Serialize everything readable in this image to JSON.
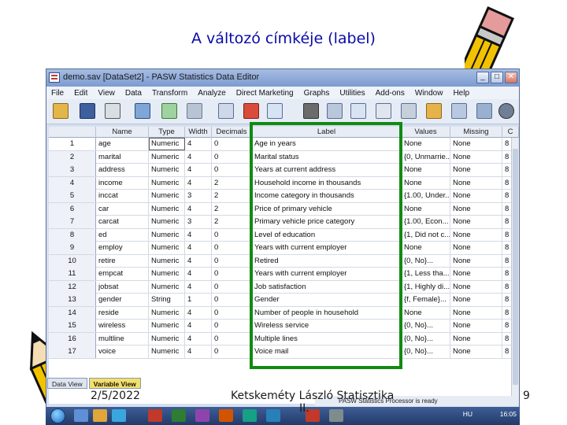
{
  "slide": {
    "title": "A változó címkéje (label)",
    "footer_date": "2/5/2022",
    "footer_author_line1": "Ketskeméty László Statisztika",
    "footer_author_line2": "II.",
    "page_number": "9"
  },
  "window": {
    "title": "demo.sav [DataSet2] - PASW Statistics Data Editor",
    "minimize": "_",
    "maximize": "□",
    "close": "✕"
  },
  "menu": [
    "File",
    "Edit",
    "View",
    "Data",
    "Transform",
    "Analyze",
    "Direct Marketing",
    "Graphs",
    "Utilities",
    "Add-ons",
    "Window",
    "Help"
  ],
  "columns": [
    "Name",
    "Type",
    "Width",
    "Decimals",
    "Label",
    "Values",
    "Missing",
    "C"
  ],
  "rows": [
    {
      "n": "1",
      "name": "age",
      "type": "Numeric",
      "width": "4",
      "dec": "0",
      "label": "Age in years",
      "values": "None",
      "missing": "None",
      "c": "8"
    },
    {
      "n": "2",
      "name": "marital",
      "type": "Numeric",
      "width": "4",
      "dec": "0",
      "label": "Marital status",
      "values": "{0, Unmarrie...",
      "missing": "None",
      "c": "8"
    },
    {
      "n": "3",
      "name": "address",
      "type": "Numeric",
      "width": "4",
      "dec": "0",
      "label": "Years at current address",
      "values": "None",
      "missing": "None",
      "c": "8"
    },
    {
      "n": "4",
      "name": "income",
      "type": "Numeric",
      "width": "4",
      "dec": "2",
      "label": "Household income in thousands",
      "values": "None",
      "missing": "None",
      "c": "8"
    },
    {
      "n": "5",
      "name": "inccat",
      "type": "Numeric",
      "width": "3",
      "dec": "2",
      "label": "Income category in thousands",
      "values": "{1.00, Under...",
      "missing": "None",
      "c": "8"
    },
    {
      "n": "6",
      "name": "car",
      "type": "Numeric",
      "width": "4",
      "dec": "2",
      "label": "Price of primary vehicle",
      "values": "None",
      "missing": "None",
      "c": "8"
    },
    {
      "n": "7",
      "name": "carcat",
      "type": "Numeric",
      "width": "3",
      "dec": "2",
      "label": "Primary vehicle price category",
      "values": "{1.00, Econ...",
      "missing": "None",
      "c": "8"
    },
    {
      "n": "8",
      "name": "ed",
      "type": "Numeric",
      "width": "4",
      "dec": "0",
      "label": "Level of education",
      "values": "{1, Did not c...",
      "missing": "None",
      "c": "8"
    },
    {
      "n": "9",
      "name": "employ",
      "type": "Numeric",
      "width": "4",
      "dec": "0",
      "label": "Years with current employer",
      "values": "None",
      "missing": "None",
      "c": "8"
    },
    {
      "n": "10",
      "name": "retire",
      "type": "Numeric",
      "width": "4",
      "dec": "0",
      "label": "Retired",
      "values": "{0, No}...",
      "missing": "None",
      "c": "8"
    },
    {
      "n": "11",
      "name": "empcat",
      "type": "Numeric",
      "width": "4",
      "dec": "0",
      "label": "Years with current employer",
      "values": "{1, Less tha...",
      "missing": "None",
      "c": "8"
    },
    {
      "n": "12",
      "name": "jobsat",
      "type": "Numeric",
      "width": "4",
      "dec": "0",
      "label": "Job satisfaction",
      "values": "{1, Highly di...",
      "missing": "None",
      "c": "8"
    },
    {
      "n": "13",
      "name": "gender",
      "type": "String",
      "width": "1",
      "dec": "0",
      "label": "Gender",
      "values": "{f, Female}...",
      "missing": "None",
      "c": "8"
    },
    {
      "n": "14",
      "name": "reside",
      "type": "Numeric",
      "width": "4",
      "dec": "0",
      "label": "Number of people in household",
      "values": "None",
      "missing": "None",
      "c": "8"
    },
    {
      "n": "15",
      "name": "wireless",
      "type": "Numeric",
      "width": "4",
      "dec": "0",
      "label": "Wireless service",
      "values": "{0, No}...",
      "missing": "None",
      "c": "8"
    },
    {
      "n": "16",
      "name": "multline",
      "type": "Numeric",
      "width": "4",
      "dec": "0",
      "label": "Multiple lines",
      "values": "{0, No}...",
      "missing": "None",
      "c": "8"
    },
    {
      "n": "17",
      "name": "voice",
      "type": "Numeric",
      "width": "4",
      "dec": "0",
      "label": "Voice mail",
      "values": "{0, No}...",
      "missing": "None",
      "c": "8"
    }
  ],
  "tabs": {
    "data_view": "Data View",
    "variable_view": "Variable View"
  },
  "status": "PASW Statistics Processor is ready",
  "taskbar": {
    "lang": "HU",
    "clock": "16:05"
  },
  "colors": {
    "title": "#0a0aa8",
    "highlight": "#128a12",
    "active_tab": "#f3e06b"
  }
}
